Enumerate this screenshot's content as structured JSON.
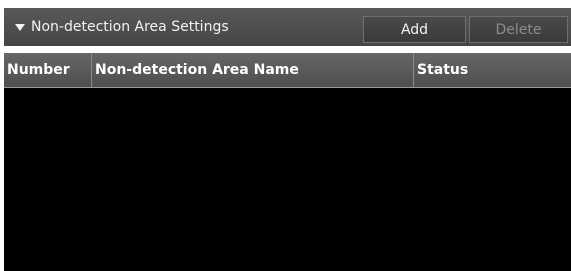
{
  "header": {
    "title": "Non-detection Area Settings",
    "add_label": "Add",
    "delete_label": "Delete"
  },
  "table": {
    "columns": [
      "Number",
      "Non-detection Area Name",
      "Status"
    ],
    "rows": []
  },
  "colors": {
    "header_bg": "#4f4f4f",
    "table_bg": "#000000",
    "disabled_text": "#8c8c8c"
  },
  "icons": {
    "collapse": "triangle-down-icon"
  }
}
